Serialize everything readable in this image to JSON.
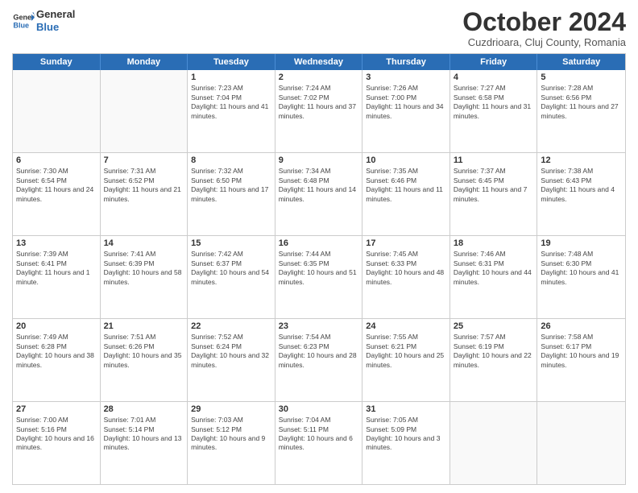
{
  "header": {
    "logo_line1": "General",
    "logo_line2": "Blue",
    "month_title": "October 2024",
    "subtitle": "Cuzdrioara, Cluj County, Romania"
  },
  "days_of_week": [
    "Sunday",
    "Monday",
    "Tuesday",
    "Wednesday",
    "Thursday",
    "Friday",
    "Saturday"
  ],
  "weeks": [
    [
      {
        "day": "",
        "empty": true
      },
      {
        "day": "",
        "empty": true
      },
      {
        "day": "1",
        "sr": "7:23 AM",
        "ss": "7:04 PM",
        "dl": "11 hours and 41 minutes."
      },
      {
        "day": "2",
        "sr": "7:24 AM",
        "ss": "7:02 PM",
        "dl": "11 hours and 37 minutes."
      },
      {
        "day": "3",
        "sr": "7:26 AM",
        "ss": "7:00 PM",
        "dl": "11 hours and 34 minutes."
      },
      {
        "day": "4",
        "sr": "7:27 AM",
        "ss": "6:58 PM",
        "dl": "11 hours and 31 minutes."
      },
      {
        "day": "5",
        "sr": "7:28 AM",
        "ss": "6:56 PM",
        "dl": "11 hours and 27 minutes."
      }
    ],
    [
      {
        "day": "6",
        "sr": "7:30 AM",
        "ss": "6:54 PM",
        "dl": "11 hours and 24 minutes."
      },
      {
        "day": "7",
        "sr": "7:31 AM",
        "ss": "6:52 PM",
        "dl": "11 hours and 21 minutes."
      },
      {
        "day": "8",
        "sr": "7:32 AM",
        "ss": "6:50 PM",
        "dl": "11 hours and 17 minutes."
      },
      {
        "day": "9",
        "sr": "7:34 AM",
        "ss": "6:48 PM",
        "dl": "11 hours and 14 minutes."
      },
      {
        "day": "10",
        "sr": "7:35 AM",
        "ss": "6:46 PM",
        "dl": "11 hours and 11 minutes."
      },
      {
        "day": "11",
        "sr": "7:37 AM",
        "ss": "6:45 PM",
        "dl": "11 hours and 7 minutes."
      },
      {
        "day": "12",
        "sr": "7:38 AM",
        "ss": "6:43 PM",
        "dl": "11 hours and 4 minutes."
      }
    ],
    [
      {
        "day": "13",
        "sr": "7:39 AM",
        "ss": "6:41 PM",
        "dl": "11 hours and 1 minute."
      },
      {
        "day": "14",
        "sr": "7:41 AM",
        "ss": "6:39 PM",
        "dl": "10 hours and 58 minutes."
      },
      {
        "day": "15",
        "sr": "7:42 AM",
        "ss": "6:37 PM",
        "dl": "10 hours and 54 minutes."
      },
      {
        "day": "16",
        "sr": "7:44 AM",
        "ss": "6:35 PM",
        "dl": "10 hours and 51 minutes."
      },
      {
        "day": "17",
        "sr": "7:45 AM",
        "ss": "6:33 PM",
        "dl": "10 hours and 48 minutes."
      },
      {
        "day": "18",
        "sr": "7:46 AM",
        "ss": "6:31 PM",
        "dl": "10 hours and 44 minutes."
      },
      {
        "day": "19",
        "sr": "7:48 AM",
        "ss": "6:30 PM",
        "dl": "10 hours and 41 minutes."
      }
    ],
    [
      {
        "day": "20",
        "sr": "7:49 AM",
        "ss": "6:28 PM",
        "dl": "10 hours and 38 minutes."
      },
      {
        "day": "21",
        "sr": "7:51 AM",
        "ss": "6:26 PM",
        "dl": "10 hours and 35 minutes."
      },
      {
        "day": "22",
        "sr": "7:52 AM",
        "ss": "6:24 PM",
        "dl": "10 hours and 32 minutes."
      },
      {
        "day": "23",
        "sr": "7:54 AM",
        "ss": "6:23 PM",
        "dl": "10 hours and 28 minutes."
      },
      {
        "day": "24",
        "sr": "7:55 AM",
        "ss": "6:21 PM",
        "dl": "10 hours and 25 minutes."
      },
      {
        "day": "25",
        "sr": "7:57 AM",
        "ss": "6:19 PM",
        "dl": "10 hours and 22 minutes."
      },
      {
        "day": "26",
        "sr": "7:58 AM",
        "ss": "6:17 PM",
        "dl": "10 hours and 19 minutes."
      }
    ],
    [
      {
        "day": "27",
        "sr": "7:00 AM",
        "ss": "5:16 PM",
        "dl": "10 hours and 16 minutes."
      },
      {
        "day": "28",
        "sr": "7:01 AM",
        "ss": "5:14 PM",
        "dl": "10 hours and 13 minutes."
      },
      {
        "day": "29",
        "sr": "7:03 AM",
        "ss": "5:12 PM",
        "dl": "10 hours and 9 minutes."
      },
      {
        "day": "30",
        "sr": "7:04 AM",
        "ss": "5:11 PM",
        "dl": "10 hours and 6 minutes."
      },
      {
        "day": "31",
        "sr": "7:05 AM",
        "ss": "5:09 PM",
        "dl": "10 hours and 3 minutes."
      },
      {
        "day": "",
        "empty": true
      },
      {
        "day": "",
        "empty": true
      }
    ]
  ]
}
